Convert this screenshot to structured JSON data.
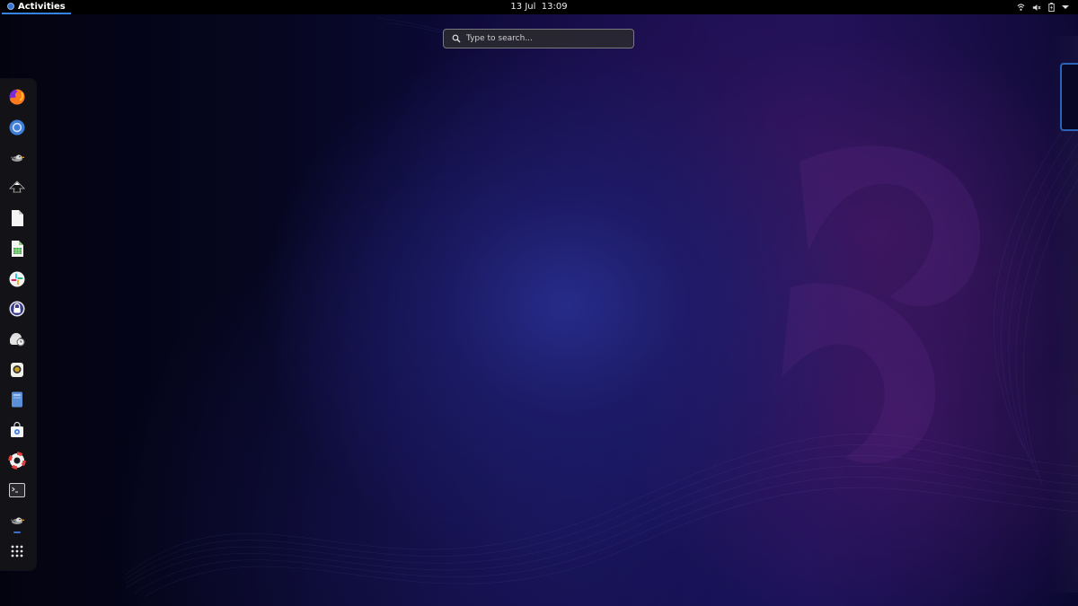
{
  "topbar": {
    "activities_label": "Activities",
    "date_label": "13 Jul",
    "time_label": "13:09",
    "tray_icons": [
      "network-icon",
      "volume-icon",
      "battery-icon",
      "system-menu-arrow-icon"
    ]
  },
  "search": {
    "placeholder": "Type to search..."
  },
  "dock": {
    "apps": [
      {
        "name": "Firefox",
        "icon": "firefox-icon"
      },
      {
        "name": "Chromium",
        "icon": "chromium-icon"
      },
      {
        "name": "Pidgin-like app",
        "icon": "bird-app-icon"
      },
      {
        "name": "Inkscape",
        "icon": "inkscape-icon"
      },
      {
        "name": "Text Document",
        "icon": "document-icon"
      },
      {
        "name": "Spreadsheet",
        "icon": "spreadsheet-icon"
      },
      {
        "name": "Slack",
        "icon": "slack-icon"
      },
      {
        "name": "Password Manager",
        "icon": "lock-icon"
      },
      {
        "name": "Timeshift",
        "icon": "backup-clock-icon"
      },
      {
        "name": "Sound Recorder",
        "icon": "recorder-icon"
      },
      {
        "name": "Files Archive",
        "icon": "archive-icon"
      },
      {
        "name": "Software Store",
        "icon": "store-bag-icon"
      },
      {
        "name": "Help",
        "icon": "lifebuoy-icon"
      },
      {
        "name": "Terminal",
        "icon": "terminal-icon"
      },
      {
        "name": "Running App",
        "icon": "bird-app-icon"
      }
    ],
    "show_apps_icon": "app-grid-icon"
  },
  "colors": {
    "accent": "#3584e4",
    "topbar_bg": "#000000",
    "dock_bg": "#141418"
  }
}
